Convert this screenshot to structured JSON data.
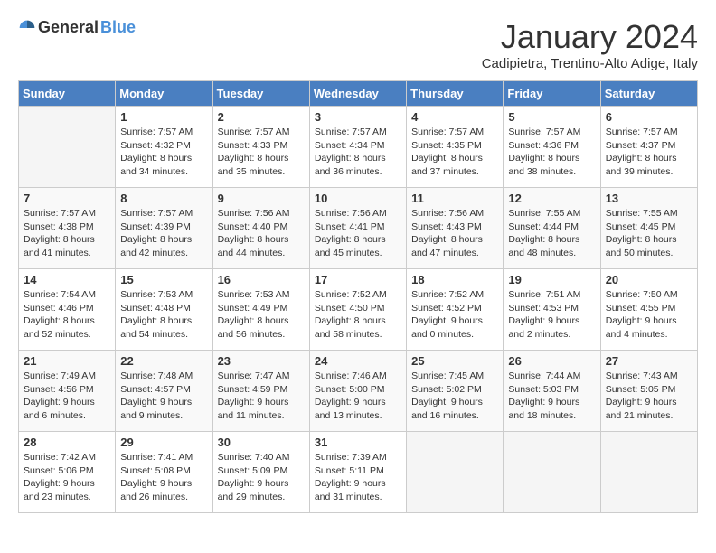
{
  "header": {
    "logo_general": "General",
    "logo_blue": "Blue",
    "month": "January 2024",
    "location": "Cadipietra, Trentino-Alto Adige, Italy"
  },
  "weekdays": [
    "Sunday",
    "Monday",
    "Tuesday",
    "Wednesday",
    "Thursday",
    "Friday",
    "Saturday"
  ],
  "weeks": [
    [
      {
        "num": "",
        "empty": true
      },
      {
        "num": "1",
        "sunrise": "7:57 AM",
        "sunset": "4:32 PM",
        "daylight": "8 hours and 34 minutes."
      },
      {
        "num": "2",
        "sunrise": "7:57 AM",
        "sunset": "4:33 PM",
        "daylight": "8 hours and 35 minutes."
      },
      {
        "num": "3",
        "sunrise": "7:57 AM",
        "sunset": "4:34 PM",
        "daylight": "8 hours and 36 minutes."
      },
      {
        "num": "4",
        "sunrise": "7:57 AM",
        "sunset": "4:35 PM",
        "daylight": "8 hours and 37 minutes."
      },
      {
        "num": "5",
        "sunrise": "7:57 AM",
        "sunset": "4:36 PM",
        "daylight": "8 hours and 38 minutes."
      },
      {
        "num": "6",
        "sunrise": "7:57 AM",
        "sunset": "4:37 PM",
        "daylight": "8 hours and 39 minutes."
      }
    ],
    [
      {
        "num": "7",
        "sunrise": "7:57 AM",
        "sunset": "4:38 PM",
        "daylight": "8 hours and 41 minutes."
      },
      {
        "num": "8",
        "sunrise": "7:57 AM",
        "sunset": "4:39 PM",
        "daylight": "8 hours and 42 minutes."
      },
      {
        "num": "9",
        "sunrise": "7:56 AM",
        "sunset": "4:40 PM",
        "daylight": "8 hours and 44 minutes."
      },
      {
        "num": "10",
        "sunrise": "7:56 AM",
        "sunset": "4:41 PM",
        "daylight": "8 hours and 45 minutes."
      },
      {
        "num": "11",
        "sunrise": "7:56 AM",
        "sunset": "4:43 PM",
        "daylight": "8 hours and 47 minutes."
      },
      {
        "num": "12",
        "sunrise": "7:55 AM",
        "sunset": "4:44 PM",
        "daylight": "8 hours and 48 minutes."
      },
      {
        "num": "13",
        "sunrise": "7:55 AM",
        "sunset": "4:45 PM",
        "daylight": "8 hours and 50 minutes."
      }
    ],
    [
      {
        "num": "14",
        "sunrise": "7:54 AM",
        "sunset": "4:46 PM",
        "daylight": "8 hours and 52 minutes."
      },
      {
        "num": "15",
        "sunrise": "7:53 AM",
        "sunset": "4:48 PM",
        "daylight": "8 hours and 54 minutes."
      },
      {
        "num": "16",
        "sunrise": "7:53 AM",
        "sunset": "4:49 PM",
        "daylight": "8 hours and 56 minutes."
      },
      {
        "num": "17",
        "sunrise": "7:52 AM",
        "sunset": "4:50 PM",
        "daylight": "8 hours and 58 minutes."
      },
      {
        "num": "18",
        "sunrise": "7:52 AM",
        "sunset": "4:52 PM",
        "daylight": "9 hours and 0 minutes."
      },
      {
        "num": "19",
        "sunrise": "7:51 AM",
        "sunset": "4:53 PM",
        "daylight": "9 hours and 2 minutes."
      },
      {
        "num": "20",
        "sunrise": "7:50 AM",
        "sunset": "4:55 PM",
        "daylight": "9 hours and 4 minutes."
      }
    ],
    [
      {
        "num": "21",
        "sunrise": "7:49 AM",
        "sunset": "4:56 PM",
        "daylight": "9 hours and 6 minutes."
      },
      {
        "num": "22",
        "sunrise": "7:48 AM",
        "sunset": "4:57 PM",
        "daylight": "9 hours and 9 minutes."
      },
      {
        "num": "23",
        "sunrise": "7:47 AM",
        "sunset": "4:59 PM",
        "daylight": "9 hours and 11 minutes."
      },
      {
        "num": "24",
        "sunrise": "7:46 AM",
        "sunset": "5:00 PM",
        "daylight": "9 hours and 13 minutes."
      },
      {
        "num": "25",
        "sunrise": "7:45 AM",
        "sunset": "5:02 PM",
        "daylight": "9 hours and 16 minutes."
      },
      {
        "num": "26",
        "sunrise": "7:44 AM",
        "sunset": "5:03 PM",
        "daylight": "9 hours and 18 minutes."
      },
      {
        "num": "27",
        "sunrise": "7:43 AM",
        "sunset": "5:05 PM",
        "daylight": "9 hours and 21 minutes."
      }
    ],
    [
      {
        "num": "28",
        "sunrise": "7:42 AM",
        "sunset": "5:06 PM",
        "daylight": "9 hours and 23 minutes."
      },
      {
        "num": "29",
        "sunrise": "7:41 AM",
        "sunset": "5:08 PM",
        "daylight": "9 hours and 26 minutes."
      },
      {
        "num": "30",
        "sunrise": "7:40 AM",
        "sunset": "5:09 PM",
        "daylight": "9 hours and 29 minutes."
      },
      {
        "num": "31",
        "sunrise": "7:39 AM",
        "sunset": "5:11 PM",
        "daylight": "9 hours and 31 minutes."
      },
      {
        "num": "",
        "empty": true
      },
      {
        "num": "",
        "empty": true
      },
      {
        "num": "",
        "empty": true
      }
    ]
  ]
}
